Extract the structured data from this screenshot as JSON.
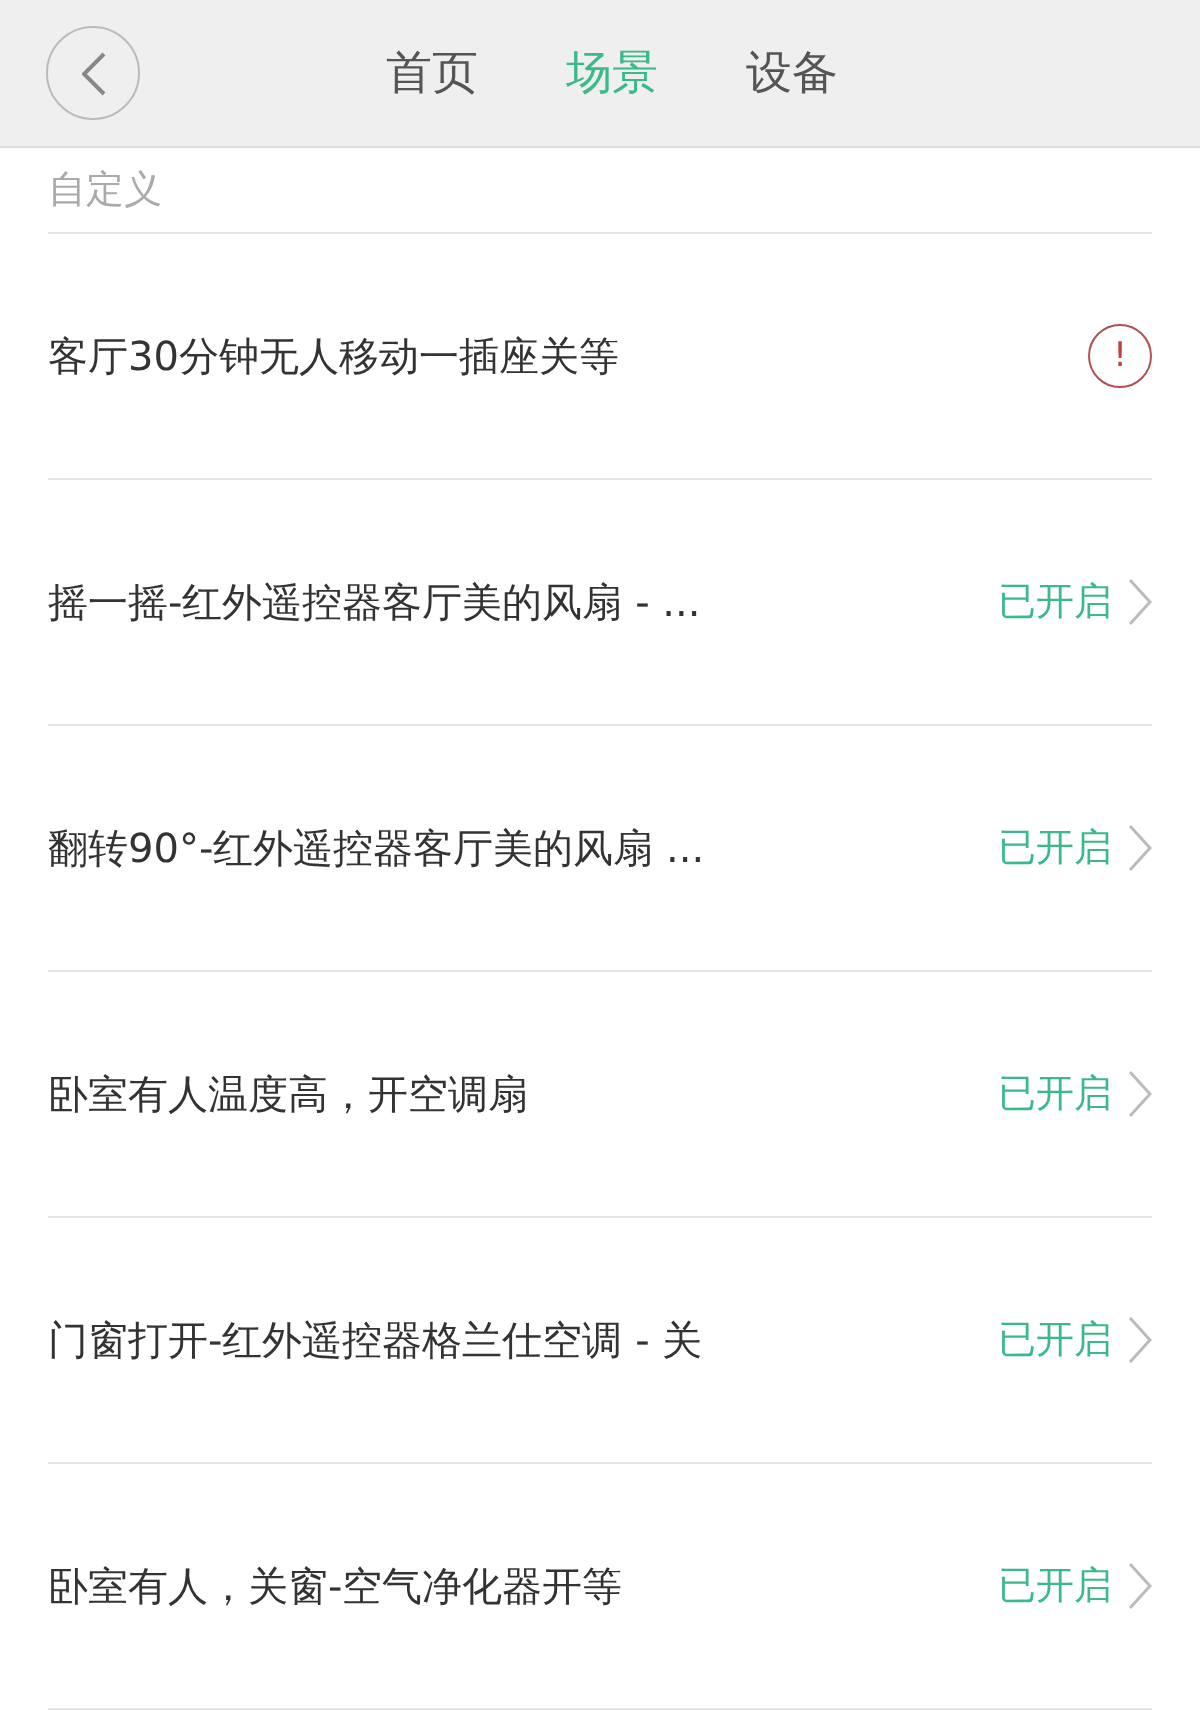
{
  "nav": {
    "tabs": [
      {
        "label": "首页",
        "selected": false
      },
      {
        "label": "场景",
        "selected": true
      },
      {
        "label": "设备",
        "selected": false
      }
    ]
  },
  "section": {
    "title": "自定义"
  },
  "scenes": [
    {
      "kind": "alert",
      "name": "客厅30分钟无人移动一插座关等",
      "icon": "!"
    },
    {
      "kind": "status",
      "name": "摇一摇-红外遥控器客厅美的风扇 - ...",
      "status": "已开启"
    },
    {
      "kind": "status",
      "name": "翻转90°-红外遥控器客厅美的风扇 ...",
      "status": "已开启"
    },
    {
      "kind": "status",
      "name": "卧室有人温度高，开空调扇",
      "status": "已开启"
    },
    {
      "kind": "status",
      "name": "门窗打开-红外遥控器格兰仕空调 - 关",
      "status": "已开启"
    },
    {
      "kind": "status",
      "name": "卧室有人，关窗-空气净化器开等",
      "status": "已开启"
    }
  ]
}
